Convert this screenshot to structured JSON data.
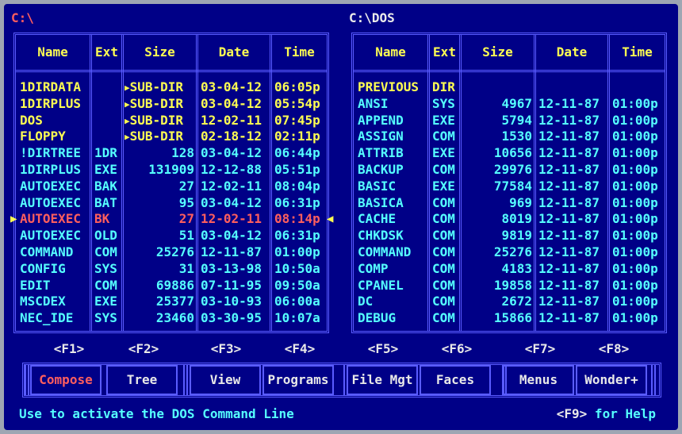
{
  "left_panel": {
    "path": "C:\\",
    "headers": {
      "name": "Name",
      "ext": "Ext",
      "size": "Size",
      "date": "Date",
      "time": "Time"
    },
    "rows": [
      {
        "name": "1DIRDATA",
        "ext": "",
        "size": "SUB-DIR",
        "date": "03-04-12",
        "time": "06:05p",
        "type": "dir"
      },
      {
        "name": "1DIRPLUS",
        "ext": "",
        "size": "SUB-DIR",
        "date": "03-04-12",
        "time": "05:54p",
        "type": "dir"
      },
      {
        "name": "DOS",
        "ext": "",
        "size": "SUB-DIR",
        "date": "12-02-11",
        "time": "07:45p",
        "type": "dir"
      },
      {
        "name": "FLOPPY",
        "ext": "",
        "size": "SUB-DIR",
        "date": "02-18-12",
        "time": "02:11p",
        "type": "dir"
      },
      {
        "name": "!DIRTREE",
        "ext": "1DR",
        "size": "128",
        "date": "03-04-12",
        "time": "06:44p",
        "type": "file"
      },
      {
        "name": "1DIRPLUS",
        "ext": "EXE",
        "size": "131909",
        "date": "12-12-88",
        "time": "05:51p",
        "type": "file"
      },
      {
        "name": "AUTOEXEC",
        "ext": "BAK",
        "size": "27",
        "date": "12-02-11",
        "time": "08:04p",
        "type": "file"
      },
      {
        "name": "AUTOEXEC",
        "ext": "BAT",
        "size": "95",
        "date": "03-04-12",
        "time": "06:31p",
        "type": "file"
      },
      {
        "name": "AUTOEXEC",
        "ext": "BK",
        "size": "27",
        "date": "12-02-11",
        "time": "08:14p",
        "type": "selected"
      },
      {
        "name": "AUTOEXEC",
        "ext": "OLD",
        "size": "51",
        "date": "03-04-12",
        "time": "06:31p",
        "type": "file"
      },
      {
        "name": "COMMAND",
        "ext": "COM",
        "size": "25276",
        "date": "12-11-87",
        "time": "01:00p",
        "type": "file"
      },
      {
        "name": "CONFIG",
        "ext": "SYS",
        "size": "31",
        "date": "03-13-98",
        "time": "10:50a",
        "type": "file"
      },
      {
        "name": "EDIT",
        "ext": "COM",
        "size": "69886",
        "date": "07-11-95",
        "time": "09:50a",
        "type": "file"
      },
      {
        "name": "MSCDEX",
        "ext": "EXE",
        "size": "25377",
        "date": "03-10-93",
        "time": "06:00a",
        "type": "file"
      },
      {
        "name": "NEC_IDE",
        "ext": "SYS",
        "size": "23460",
        "date": "03-30-95",
        "time": "10:07a",
        "type": "file"
      }
    ]
  },
  "right_panel": {
    "path": "C:\\DOS",
    "headers": {
      "name": "Name",
      "ext": "Ext",
      "size": "Size",
      "date": "Date",
      "time": "Time"
    },
    "rows": [
      {
        "name": "PREVIOUS",
        "ext": "DIR",
        "size": "",
        "date": "",
        "time": "",
        "type": "dir"
      },
      {
        "name": "ANSI",
        "ext": "SYS",
        "size": "4967",
        "date": "12-11-87",
        "time": "01:00p",
        "type": "file"
      },
      {
        "name": "APPEND",
        "ext": "EXE",
        "size": "5794",
        "date": "12-11-87",
        "time": "01:00p",
        "type": "file"
      },
      {
        "name": "ASSIGN",
        "ext": "COM",
        "size": "1530",
        "date": "12-11-87",
        "time": "01:00p",
        "type": "file"
      },
      {
        "name": "ATTRIB",
        "ext": "EXE",
        "size": "10656",
        "date": "12-11-87",
        "time": "01:00p",
        "type": "file"
      },
      {
        "name": "BACKUP",
        "ext": "COM",
        "size": "29976",
        "date": "12-11-87",
        "time": "01:00p",
        "type": "file"
      },
      {
        "name": "BASIC",
        "ext": "EXE",
        "size": "77584",
        "date": "12-11-87",
        "time": "01:00p",
        "type": "file"
      },
      {
        "name": "BASICA",
        "ext": "COM",
        "size": "969",
        "date": "12-11-87",
        "time": "01:00p",
        "type": "file"
      },
      {
        "name": "CACHE",
        "ext": "COM",
        "size": "8019",
        "date": "12-11-87",
        "time": "01:00p",
        "type": "file"
      },
      {
        "name": "CHKDSK",
        "ext": "COM",
        "size": "9819",
        "date": "12-11-87",
        "time": "01:00p",
        "type": "file"
      },
      {
        "name": "COMMAND",
        "ext": "COM",
        "size": "25276",
        "date": "12-11-87",
        "time": "01:00p",
        "type": "file"
      },
      {
        "name": "COMP",
        "ext": "COM",
        "size": "4183",
        "date": "12-11-87",
        "time": "01:00p",
        "type": "file"
      },
      {
        "name": "CPANEL",
        "ext": "COM",
        "size": "19858",
        "date": "12-11-87",
        "time": "01:00p",
        "type": "file"
      },
      {
        "name": "DC",
        "ext": "COM",
        "size": "2672",
        "date": "12-11-87",
        "time": "01:00p",
        "type": "file"
      },
      {
        "name": "DEBUG",
        "ext": "COM",
        "size": "15866",
        "date": "12-11-87",
        "time": "01:00p",
        "type": "file"
      }
    ]
  },
  "function_keys": [
    "<F1>",
    "<F2>",
    "<F3>",
    "<F4>",
    "<F5>",
    "<F6>",
    "<F7>",
    "<F8>"
  ],
  "buttons": [
    "Compose",
    "Tree",
    "View",
    "Programs",
    "File Mgt",
    "Faces",
    "Menus",
    "Wonder+"
  ],
  "status": {
    "message": "Use to activate the DOS Command Line",
    "help_key": "<F9>",
    "help_text": " for Help"
  },
  "colors": {
    "background": "#000087",
    "directory": "#ffff52",
    "file": "#55ffff",
    "selected": "#ff5e5e",
    "border": "#5a5cff"
  }
}
